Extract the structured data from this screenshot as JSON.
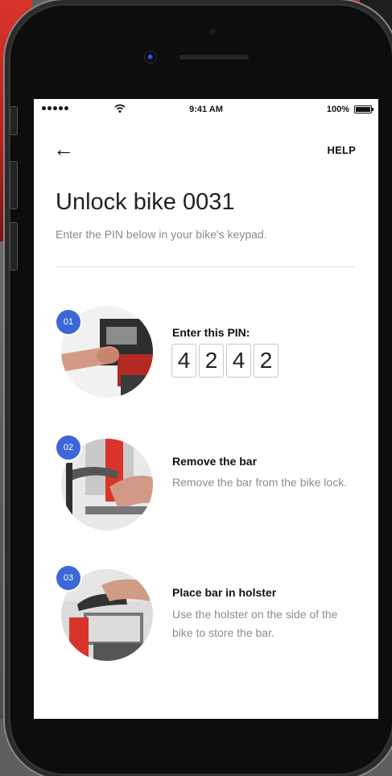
{
  "status_bar": {
    "time": "9:41 AM",
    "battery": "100%",
    "wifi_icon": "wifi-icon",
    "signal_icon": "signal-dots-icon",
    "battery_icon": "battery-icon"
  },
  "nav": {
    "back_icon": "arrow-left-icon",
    "back_glyph": "←",
    "help_label": "HELP"
  },
  "header": {
    "title": "Unlock bike 0031",
    "subtitle": "Enter the PIN below in your bike's keypad."
  },
  "steps": [
    {
      "number": "01",
      "heading": "Enter this PIN:",
      "body": ""
    },
    {
      "number": "02",
      "heading": "Remove the bar",
      "body": "Remove the bar from the bike lock."
    },
    {
      "number": "03",
      "heading": "Place bar in holster",
      "body": "Use the holster on the side of the bike to store the bar."
    }
  ],
  "pin": {
    "digits": [
      "4",
      "2",
      "4",
      "2"
    ]
  },
  "colors": {
    "badge_blue": "#3d67d8",
    "bike_red": "#d8342c"
  }
}
